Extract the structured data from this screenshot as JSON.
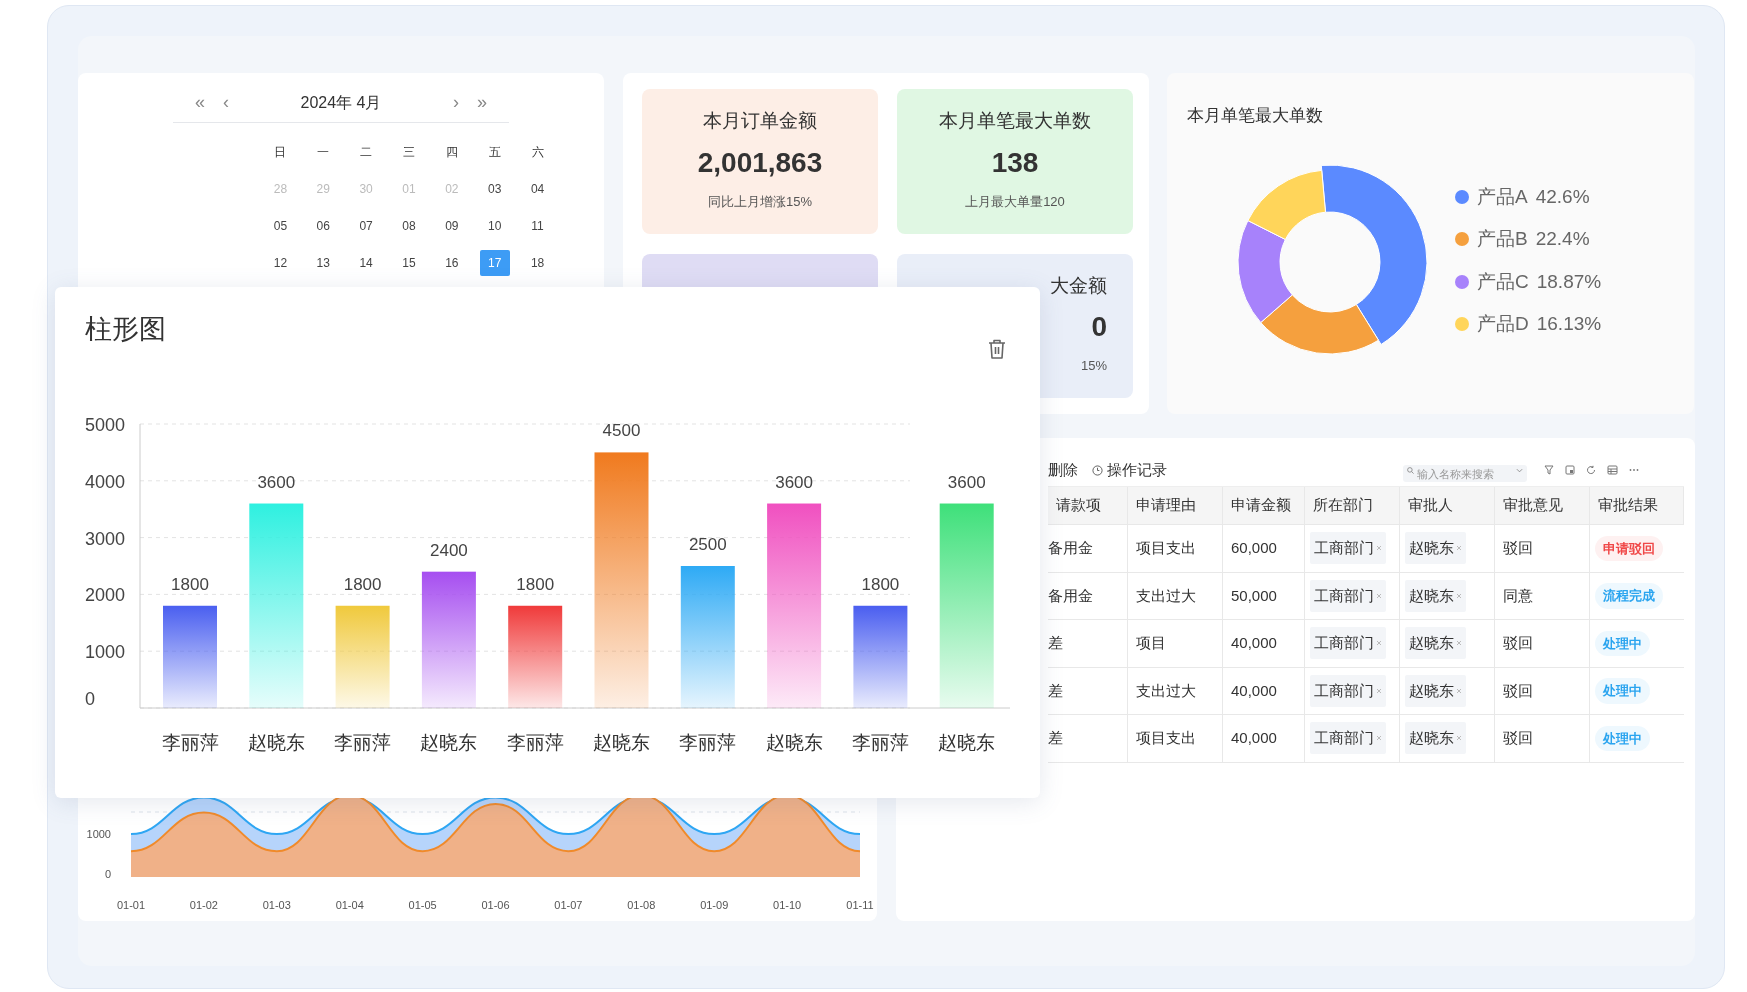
{
  "calendar": {
    "nav": [
      "«",
      "‹",
      "›",
      "»"
    ],
    "title": "2024年 4月",
    "weekdays": [
      "日",
      "一",
      "二",
      "三",
      "四",
      "五",
      "六"
    ],
    "days": [
      {
        "label": "28",
        "muted": true,
        "selected": false
      },
      {
        "label": "29",
        "muted": true,
        "selected": false
      },
      {
        "label": "30",
        "muted": true,
        "selected": false
      },
      {
        "label": "01",
        "muted": true,
        "selected": false
      },
      {
        "label": "02",
        "muted": true,
        "selected": false
      },
      {
        "label": "03",
        "muted": false,
        "selected": false
      },
      {
        "label": "04",
        "muted": false,
        "selected": false
      },
      {
        "label": "05",
        "muted": false,
        "selected": false
      },
      {
        "label": "06",
        "muted": false,
        "selected": false
      },
      {
        "label": "07",
        "muted": false,
        "selected": false
      },
      {
        "label": "08",
        "muted": false,
        "selected": false
      },
      {
        "label": "09",
        "muted": false,
        "selected": false
      },
      {
        "label": "10",
        "muted": false,
        "selected": false
      },
      {
        "label": "11",
        "muted": false,
        "selected": false
      },
      {
        "label": "12",
        "muted": false,
        "selected": false
      },
      {
        "label": "13",
        "muted": false,
        "selected": false
      },
      {
        "label": "14",
        "muted": false,
        "selected": false
      },
      {
        "label": "15",
        "muted": false,
        "selected": false
      },
      {
        "label": "16",
        "muted": false,
        "selected": false
      },
      {
        "label": "17",
        "muted": false,
        "selected": true
      },
      {
        "label": "18",
        "muted": false,
        "selected": false
      }
    ]
  },
  "stat_cards": [
    {
      "title": "本月订单金额",
      "value": "2,001,863",
      "note": "同比上月增涨15%",
      "color": "#fdeee6"
    },
    {
      "title": "本月单笔最大单数",
      "value": "138",
      "note": "上月最大单量120",
      "color": "#e0f7e3"
    },
    {
      "color": "#dfdcf4"
    },
    {
      "title": "大金额",
      "value": "0",
      "note": "15%",
      "color": "#e9eef8"
    }
  ],
  "donut": {
    "title": "本月单笔最大单数",
    "legend": [
      {
        "value": "42.6%",
        "color": "#5b8aff"
      },
      {
        "value": "22.4%",
        "color": "#f5a03e"
      },
      {
        "value": "18.87%",
        "color": "#a782fb"
      },
      {
        "value": "16.13%",
        "color": "#ffd55a"
      }
    ],
    "chart_data": {
      "type": "donut",
      "categories": [
        "产品A",
        "产品B",
        "产品C",
        "产品D"
      ],
      "series": [
        {
          "values": [
            42.6,
            22.4,
            18.87,
            16.13
          ]
        }
      ]
    }
  },
  "area_chart": {
    "y_labels": [
      "1000",
      "0"
    ],
    "x_labels": [
      "01-01",
      "01-02",
      "01-03",
      "01-04",
      "01-05",
      "01-06",
      "01-07",
      "01-08",
      "01-09",
      "01-10",
      "01-11"
    ]
  },
  "table": {
    "toolbar": {
      "delete": "删除",
      "history": "操作记录",
      "search_placeholder": "输入名称来搜索"
    },
    "columns": [
      "请款项",
      "申请理由",
      "申请金额",
      "所在部门",
      "审批人",
      "审批意见",
      "审批结果"
    ],
    "rows": [
      {
        "item": "备用金",
        "reason": "项目支出",
        "amount": "60,000",
        "dept": "工商部门",
        "approver": "赵晓东",
        "opinion": "驳回",
        "result": "申请驳回",
        "color": "#f04848"
      },
      {
        "item": "备用金",
        "reason": "支出过大",
        "amount": "50,000",
        "dept": "工商部门",
        "approver": "赵晓东",
        "opinion": "同意",
        "result": "流程完成",
        "color": "#2aa4ef"
      },
      {
        "item": "差",
        "reason": "项目",
        "amount": "40,000",
        "dept": "工商部门",
        "approver": "赵晓东",
        "opinion": "驳回",
        "result": "处理中",
        "color": "#2aa4ef"
      },
      {
        "item": "差",
        "reason": "支出过大",
        "amount": "40,000",
        "dept": "工商部门",
        "approver": "赵晓东",
        "opinion": "驳回",
        "result": "处理中",
        "color": "#2aa4ef"
      },
      {
        "item": "差",
        "reason": "项目支出",
        "amount": "40,000",
        "dept": "工商部门",
        "approver": "赵晓东",
        "opinion": "驳回",
        "result": "处理中",
        "color": "#2aa4ef"
      }
    ]
  },
  "bar_chart": {
    "title": "柱形图",
    "bars": [
      {
        "color": "#4a5ff0"
      },
      {
        "color": "#2ef0e0"
      },
      {
        "color": "#f0c93c"
      },
      {
        "color": "#a64ef0"
      },
      {
        "color": "#f03a3a"
      },
      {
        "color": "#f07a1e"
      },
      {
        "color": "#2eaaf5"
      },
      {
        "color": "#f050c0"
      },
      {
        "color": "#4a5ef0"
      },
      {
        "color": "#3ee07a"
      }
    ],
    "chart_data": {
      "type": "bar",
      "categories": [
        "李丽萍",
        "赵晓东",
        "李丽萍",
        "赵晓东",
        "李丽萍",
        "赵晓东",
        "李丽萍",
        "赵晓东",
        "李丽萍",
        "赵晓东"
      ],
      "series": [
        {
          "values": [
            1800,
            3600,
            1800,
            2400,
            1800,
            4500,
            2500,
            3600,
            1800,
            3600
          ]
        }
      ],
      "ylim": [
        0,
        5000
      ],
      "yticks": [
        0,
        1000,
        2000,
        3000,
        4000,
        5000
      ],
      "grid": true,
      "data_labels": true
    }
  }
}
